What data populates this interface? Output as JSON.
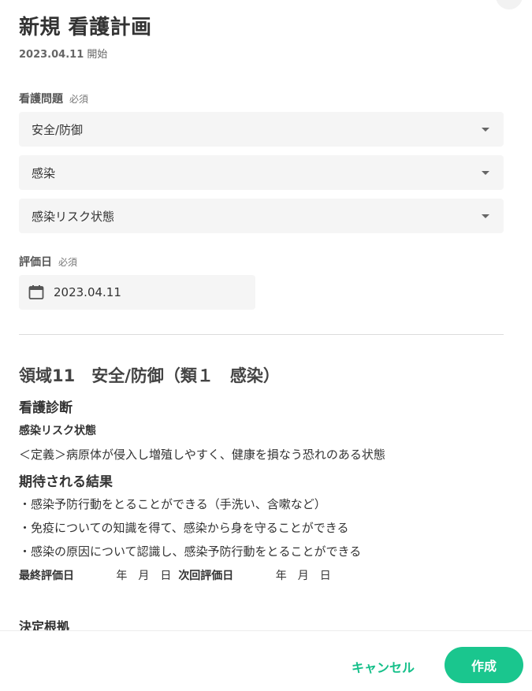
{
  "header": {
    "title": "新規 看護計画",
    "start_date": "2023.04.11",
    "start_label": "開始"
  },
  "nursing_problem": {
    "label": "看護問題",
    "required": "必須",
    "selects": [
      "安全/防御",
      "感染",
      "感染リスク状態"
    ]
  },
  "evaluation_date": {
    "label": "評価日",
    "required": "必須",
    "value": "2023.04.11",
    "icon": "calendar-icon"
  },
  "plan": {
    "area_title": "領域11　安全/防御（類１　感染）",
    "diagnosis_heading": "看護診断",
    "diagnosis_name": "感染リスク状態",
    "definition": "＜定義＞病原体が侵入し増殖しやすく、健康を損なう恐れのある状態",
    "outcomes_heading": "期待される結果",
    "outcomes": [
      "・感染予防行動をとることができる（手洗い、含嗽など）",
      "・免疫についての知識を得て、感染から身を守ることができる",
      "・感染の原因について認識し、感染予防行動をとることができる"
    ],
    "last_eval_label": "最終評価日",
    "last_eval_date": "年　月　日",
    "next_eval_label": "次回評価日",
    "next_eval_date": "年　月　日",
    "basis_heading": "決定根拠"
  },
  "footer": {
    "cancel_label": "キャンセル",
    "create_label": "作成"
  },
  "colors": {
    "accent": "#1ac68e",
    "field_bg": "#f5f5f5"
  }
}
